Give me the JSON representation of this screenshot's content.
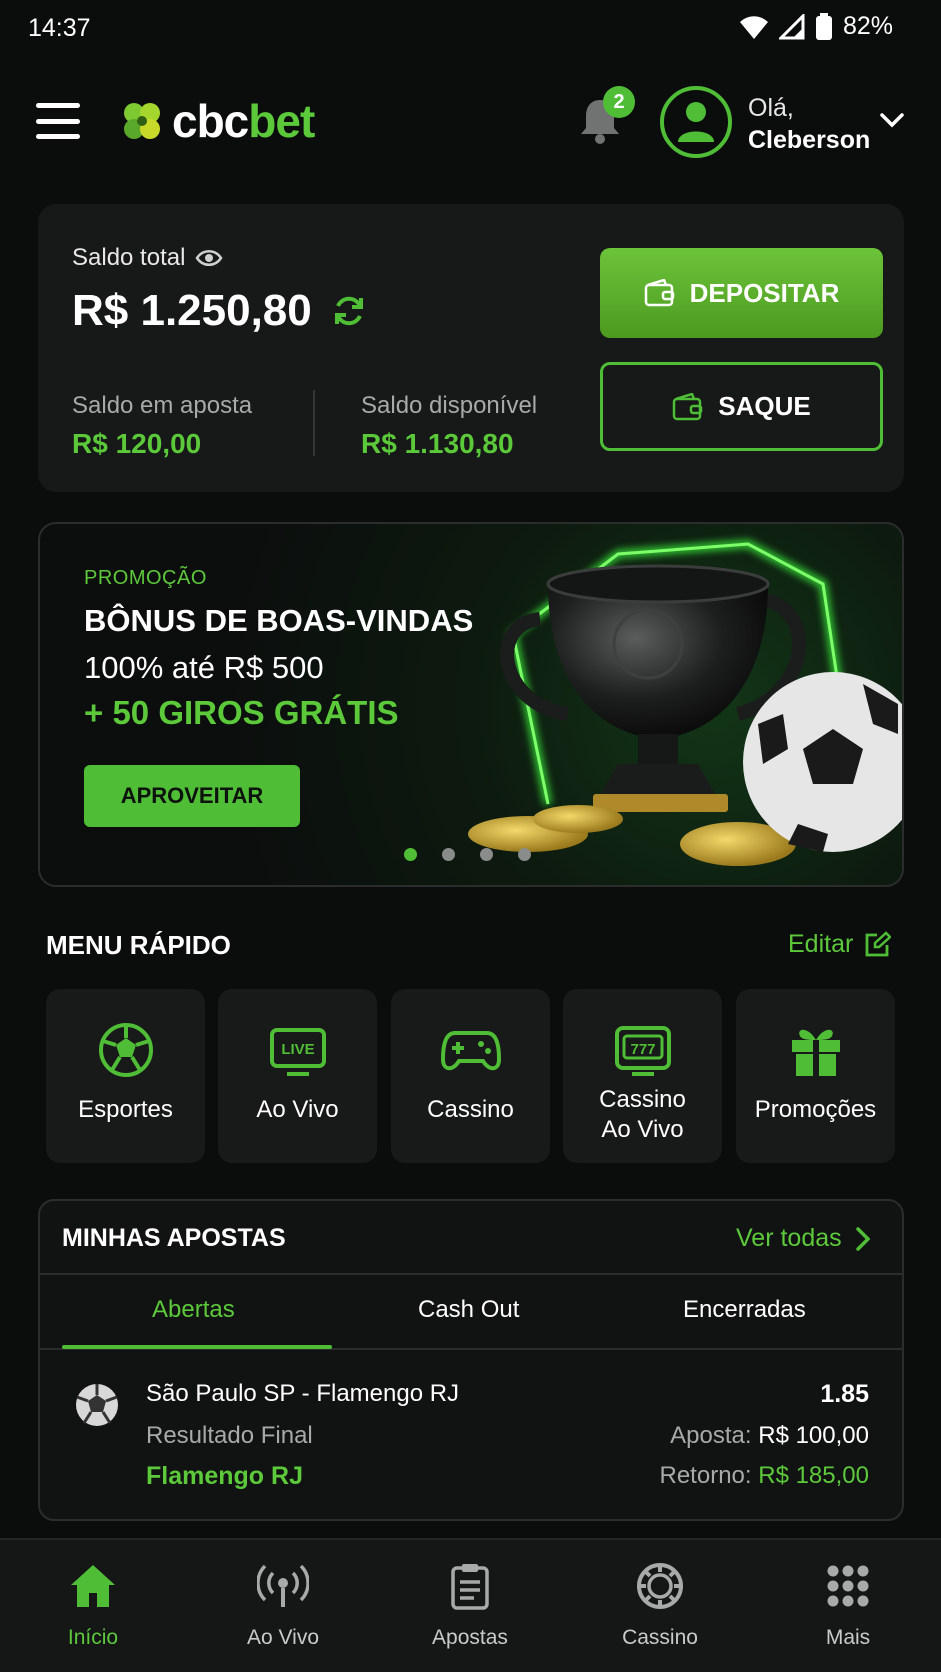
{
  "status_bar": {
    "time": "14:37",
    "battery": "82%"
  },
  "header": {
    "logo_part1": "cbc",
    "logo_part2": "bet",
    "notifications_count": "2",
    "greeting": "Olá,",
    "user_name": "Cleberson"
  },
  "balance": {
    "total_label": "Saldo total",
    "total_value": "R$ 1.250,80",
    "bet_label": "Saldo em aposta",
    "bet_value": "R$ 120,00",
    "available_label": "Saldo disponível",
    "available_value": "R$ 1.130,80",
    "deposit_label": "DEPOSITAR",
    "withdraw_label": "SAQUE"
  },
  "promo": {
    "tag": "PROMOÇÃO",
    "title": "BÔNUS DE BOAS-VINDAS",
    "subtitle": "100% até R$ 500",
    "extra": "+ 50 GIROS GRÁTIS",
    "cta": "APROVEITAR",
    "slides": 4,
    "active_slide": 1
  },
  "quick_menu": {
    "title": "MENU RÁPIDO",
    "edit_label": "Editar",
    "items": [
      {
        "label": "Esportes",
        "icon": "soccer-ball-icon"
      },
      {
        "label": "Ao Vivo",
        "icon": "live-tv-icon",
        "icon_text": "LIVE"
      },
      {
        "label": "Cassino",
        "icon": "gamepad-icon"
      },
      {
        "label_line1": "Cassino",
        "label_line2": "Ao Vivo",
        "icon": "slot-machine-icon",
        "icon_text": "777"
      },
      {
        "label": "Promoções",
        "icon": "gift-icon"
      }
    ]
  },
  "my_bets": {
    "title": "MINHAS APOSTAS",
    "see_all": "Ver todas",
    "tabs": [
      "Abertas",
      "Cash Out",
      "Encerradas"
    ],
    "active_tab": 0,
    "bet": {
      "match": "São Paulo SP - Flamengo RJ",
      "market": "Resultado Final",
      "pick": "Flamengo RJ",
      "odd": "1.85",
      "stake_label": "Aposta:",
      "stake_value": "R$ 100,00",
      "return_label": "Retorno:",
      "return_value": "R$ 185,00"
    }
  },
  "bottom_nav": {
    "items": [
      {
        "label": "Início",
        "icon": "home-icon",
        "active": true
      },
      {
        "label": "Ao Vivo",
        "icon": "broadcast-icon",
        "active": false
      },
      {
        "label": "Apostas",
        "icon": "clipboard-icon",
        "active": false
      },
      {
        "label": "Cassino",
        "icon": "casino-chip-icon",
        "active": false
      },
      {
        "label": "Mais",
        "icon": "grid-dots-icon",
        "active": false
      }
    ]
  },
  "colors": {
    "accent": "#4fbd36",
    "background": "#0b0d0c",
    "card": "#161917"
  }
}
